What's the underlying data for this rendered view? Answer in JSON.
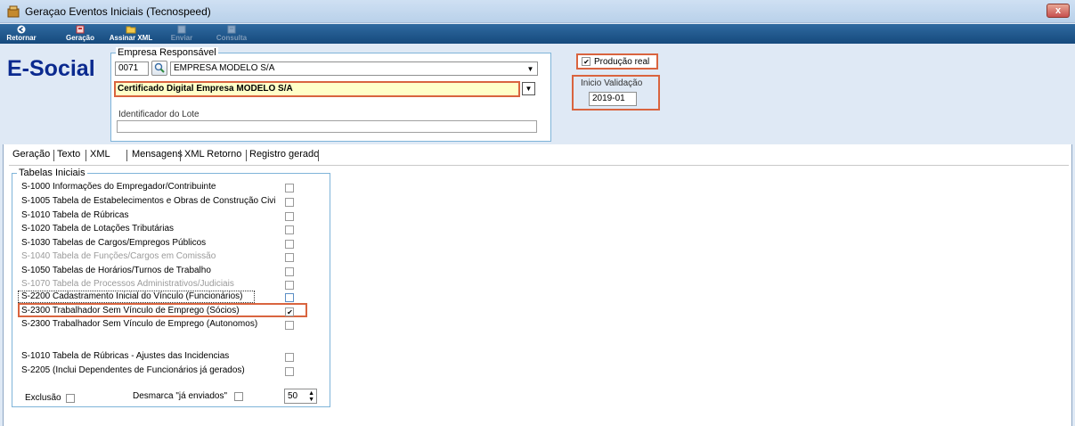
{
  "window": {
    "title": "Geraçao Eventos Iniciais (Tecnospeed)",
    "close_glyph": "x"
  },
  "toolbar": {
    "retornar": "Retornar",
    "geracao": "Geração",
    "assinar": "Assinar XML",
    "enviar": "Enviar",
    "consulta": "Consulta"
  },
  "header": {
    "brand": "E-Social",
    "empresa": {
      "legend": "Empresa Responsável",
      "code": "0071",
      "name": "EMPRESA MODELO S/A",
      "certificate": "Certificado Digital Empresa MODELO S/A",
      "lote_label": "Identificador do Lote",
      "lote_value": ""
    },
    "producao": {
      "label": "Produção real",
      "checked": true
    },
    "validacao": {
      "label": "Inicio Validação",
      "value": "2019-01"
    }
  },
  "tabs": [
    "Geração",
    "Texto",
    "XML",
    "Mensagens",
    "XML Retorno",
    "Registro gerado"
  ],
  "tabelas": {
    "legend": "Tabelas Iniciais",
    "items": [
      {
        "label": "S-1000 Informações do Empregador/Contribuinte",
        "checked": false,
        "enabled": true
      },
      {
        "label": "S-1005 Tabela de Estabelecimentos e Obras de Construção Civi",
        "checked": false,
        "enabled": true
      },
      {
        "label": "S-1010 Tabela de Rúbricas",
        "checked": false,
        "enabled": true
      },
      {
        "label": "S-1020 Tabela de Lotações Tributárias",
        "checked": false,
        "enabled": true
      },
      {
        "label": "S-1030 Tabelas de Cargos/Empregos Públicos",
        "checked": false,
        "enabled": true
      },
      {
        "label": "S-1040 Tabela de Funções/Cargos em Comissão",
        "checked": false,
        "enabled": false
      },
      {
        "label": "S-1050 Tabelas de Horários/Turnos de Trabalho",
        "checked": false,
        "enabled": true
      },
      {
        "label": "S-1070 Tabela de Processos Administrativos/Judiciais",
        "checked": false,
        "enabled": false
      },
      {
        "label": "S-2200 Cadastramento Inicial do Vínculo (Funcionários)",
        "checked": false,
        "enabled": true
      },
      {
        "label": "S-2300 Trabalhador Sem Vínculo de Emprego (Sócios)",
        "checked": true,
        "enabled": true
      },
      {
        "label": "S-2300 Trabalhador Sem Vínculo de Emprego (Autonomos)",
        "checked": false,
        "enabled": true
      },
      {
        "label": "S-1010 Tabela de Rúbricas - Ajustes das Incidencias",
        "checked": false,
        "enabled": true
      },
      {
        "label": "S-2205 (Inclui Dependentes de Funcionários já gerados)",
        "checked": false,
        "enabled": true
      }
    ],
    "exclusao_label": "Exclusão",
    "desmarca_label": "Desmarca \"já enviados\"",
    "spin_value": "50"
  }
}
